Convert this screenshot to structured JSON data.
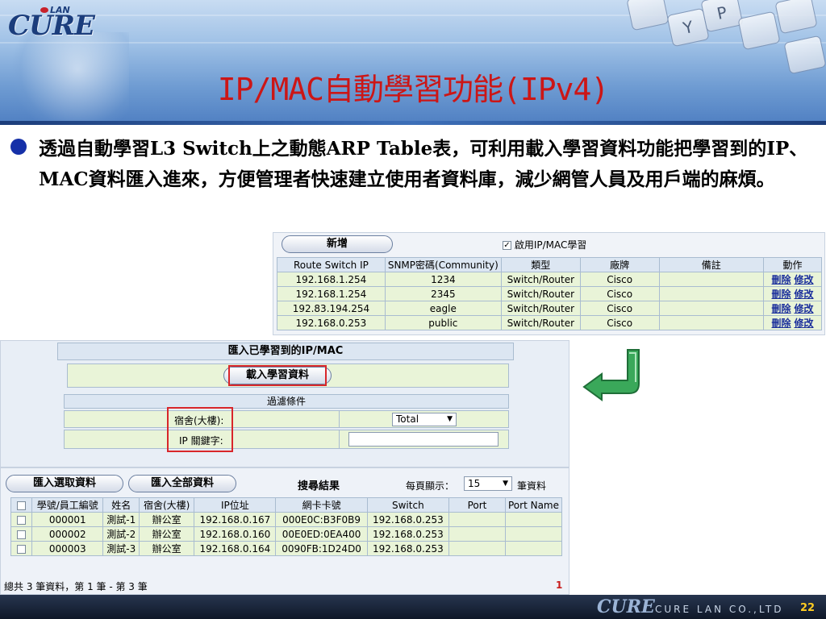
{
  "header": {
    "logo_lan": "LAN",
    "logo_text": "CURE",
    "title": "IP/MAC自動學習功能(IPv4)",
    "keys": [
      "Y",
      "P"
    ]
  },
  "bullet": {
    "text": "透過自動學習L3 Switch上之動態ARP Table表，可利用載入學習資料功能把學習到的IP、MAC資料匯入進來，方便管理者快速建立使用者資料庫，減少網管人員及用戶端的麻煩。"
  },
  "arp_panel": {
    "add_button": "新增",
    "enable_checkbox_label": "啟用IP/MAC學習",
    "enable_checked": true,
    "columns": [
      "Route Switch IP",
      "SNMP密碼(Community)",
      "類型",
      "廠牌",
      "備註",
      "動作"
    ],
    "rows": [
      {
        "ip": "192.168.1.254",
        "community": "1234",
        "type": "Switch/Router",
        "brand": "Cisco",
        "note": ""
      },
      {
        "ip": "192.168.1.254",
        "community": "2345",
        "type": "Switch/Router",
        "brand": "Cisco",
        "note": ""
      },
      {
        "ip": "192.83.194.254",
        "community": "eagle",
        "type": "Switch/Router",
        "brand": "Cisco",
        "note": ""
      },
      {
        "ip": "192.168.0.253",
        "community": "public",
        "type": "Switch/Router",
        "brand": "Cisco",
        "note": ""
      }
    ],
    "delete_label": "刪除",
    "edit_label": "修改"
  },
  "import_panel": {
    "title": "匯入已學習到的IP/MAC",
    "load_button": "載入學習資料",
    "filter_title": "過濾條件",
    "dorm_label": "宿舍(大樓):",
    "dorm_value": "Total",
    "ip_keyword_label": "IP 關鍵字:",
    "ip_keyword_value": ""
  },
  "results_panel": {
    "import_selected_button": "匯入選取資料",
    "import_all_button": "匯入全部資料",
    "search_result_label": "搜尋結果",
    "per_page_label": "每頁顯示：",
    "per_page_value": "15",
    "per_page_unit": "筆資料",
    "columns": [
      "學號/員工編號",
      "姓名",
      "宿舍(大樓)",
      "IP位址",
      "網卡卡號",
      "Switch",
      "Port",
      "Port Name"
    ],
    "rows": [
      {
        "id": "000001",
        "name": "測試-1",
        "dorm": "辦公室",
        "ip": "192.168.0.167",
        "mac": "000E0C:B3F0B9",
        "switch": "192.168.0.253",
        "port": "",
        "port_name": ""
      },
      {
        "id": "000002",
        "name": "測試-2",
        "dorm": "辦公室",
        "ip": "192.168.0.160",
        "mac": "00E0ED:0EA400",
        "switch": "192.168.0.253",
        "port": "",
        "port_name": ""
      },
      {
        "id": "000003",
        "name": "測試-3",
        "dorm": "辦公室",
        "ip": "192.168.0.164",
        "mac": "0090FB:1D24D0",
        "switch": "192.168.0.253",
        "port": "",
        "port_name": ""
      }
    ],
    "summary": "總共 3 筆資料，第 1 筆 - 第 3 筆",
    "page_number": "1"
  },
  "footer": {
    "logo_text": "CURE",
    "company": "CURE LAN CO.,LTD",
    "page": "22"
  },
  "colors": {
    "title_red": "#cc1616",
    "bullet_blue": "#1530a8",
    "highlight_red": "#d8262a",
    "arrow_green": "#3aa85a",
    "row_green": "#e9f4d8"
  }
}
